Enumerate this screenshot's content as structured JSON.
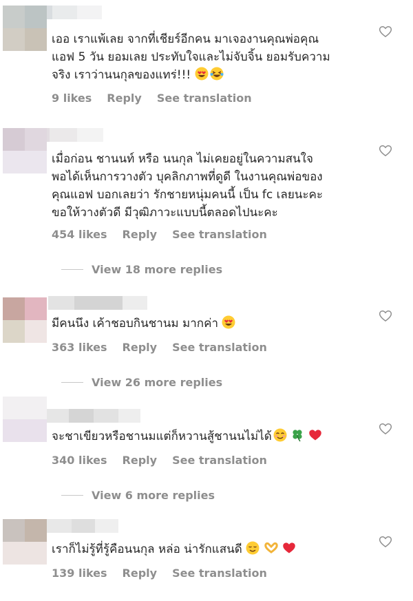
{
  "comments": [
    {
      "text": "เออ เราแพ้เลย จากที่เชียร์อีกคน มาเจองานคุณพ่อคุณ\nแอฟ 5 วัน ยอมเลย ประทับใจและไม่จับจิ้น ยอมรับความ\nจริง เราว่านนกุลของแทร่!!!",
      "emojis": [
        "heart-eyes",
        "laughing-tears"
      ],
      "likes": "9 likes",
      "reply": "Reply",
      "translate": "See translation"
    },
    {
      "text": "เมื่อก่อน ชานนท์ หรือ นนกุล ไม่เคยอยู่ในความสนใจ\nพอได้เห็นการวางตัว บุคลิกภาพที่ดูดี ในงานคุณพ่อของ\nคุณแอฟ บอกเลยว่า รักชายหนุ่มคนนี้ เป็น fc เลยนะคะ\nขอให้วางตัวดี มีวุฒิภาวะแบบนี้ตลอดไปนะคะ",
      "emojis": [],
      "likes": "454 likes",
      "reply": "Reply",
      "translate": "See translation",
      "view_more": "View 18 more replies"
    },
    {
      "text": "มีคนนึง เค้าชอบกินชานม มากค่า",
      "emojis": [
        "heart-eyes"
      ],
      "likes": "363 likes",
      "reply": "Reply",
      "translate": "See translation",
      "view_more": "View 26 more replies"
    },
    {
      "text": "จะชาเขียวหรือชานมแต่ก็หวานสู้ชานนไม่ได้",
      "emojis": [
        "blush",
        "four-leaf-clover",
        "red-heart"
      ],
      "likes": "340 likes",
      "reply": "Reply",
      "translate": "See translation",
      "view_more": "View 6 more replies"
    },
    {
      "text": "เราก็ไม่รู้ที่รู้คือนนกุล หล่อ น่ารักแสนดี",
      "emojis": [
        "relieved-smile",
        "heart-hands",
        "red-heart"
      ],
      "likes": "139 likes",
      "reply": "Reply",
      "translate": "See translation"
    }
  ],
  "colors": {
    "text": "#262626",
    "meta": "#8e8e8e",
    "line": "#c7c7c7"
  }
}
